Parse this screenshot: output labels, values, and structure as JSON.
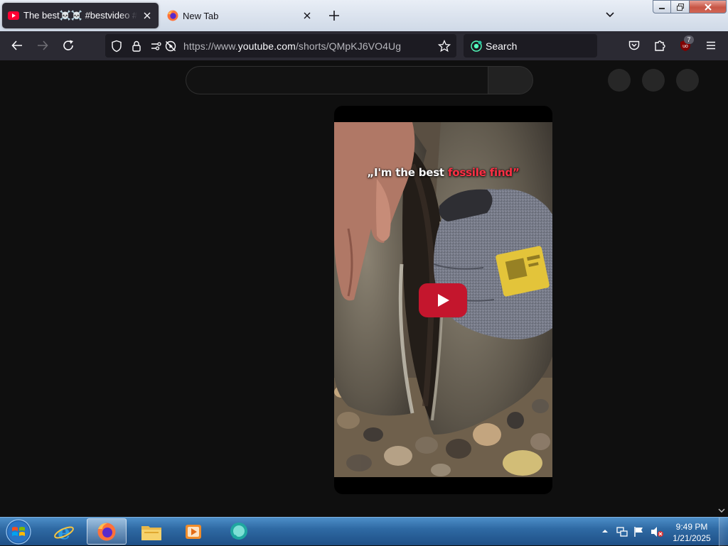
{
  "browser": {
    "tabs": [
      {
        "title": "The best☠️☠️ #bestvideo #trollface",
        "active": true,
        "favicon": "youtube-icon"
      },
      {
        "title": "New Tab",
        "active": false,
        "favicon": "firefox-icon"
      }
    ],
    "url": {
      "prefix": "https://www.",
      "domain": "youtube.com",
      "path": "/shorts/QMpKJ6VO4Ug"
    },
    "search_placeholder": "Search",
    "extension_badge": "7",
    "colors": {
      "toolbar": "#2b2a33",
      "urlbar": "#1c1b22",
      "tab_strip": "#dfe6f0"
    }
  },
  "page": {
    "caption": {
      "part1": "„I'm the best ",
      "part2": "fossile find”"
    },
    "colors": {
      "background": "#0f0f0f",
      "play_button": "#c4162d",
      "caption_accent": "#ff3045"
    }
  },
  "taskbar": {
    "time": "9:49 PM",
    "date": "1/21/2025",
    "pinned": [
      "internet-explorer-icon",
      "firefox-icon",
      "file-explorer-icon",
      "media-player-icon",
      "chat-app-icon"
    ]
  }
}
